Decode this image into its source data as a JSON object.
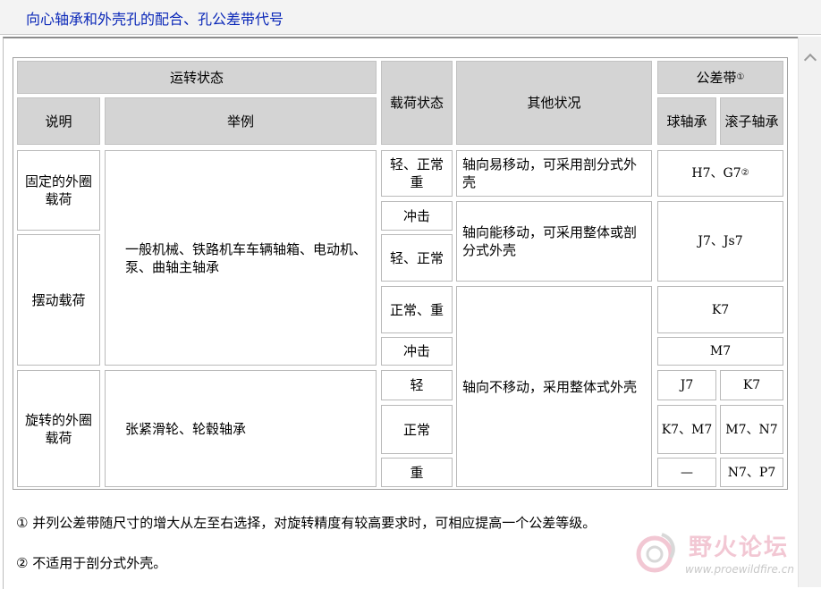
{
  "title": "向心轴承和外壳孔的配合、孔公差带代号",
  "table": {
    "headers": {
      "running_state": "运转状态",
      "description": "说明",
      "example": "举例",
      "load_state": "载荷状态",
      "other": "其他状况",
      "tolerance": "公差带",
      "tolerance_mark": "①",
      "ball": "球轴承",
      "roller": "滚子轴承"
    },
    "descriptions": [
      "固定的外圈载荷",
      "摆动载荷",
      "旋转的外圈载荷"
    ],
    "examples": [
      "一般机械、铁路机车车辆轴箱、电动机、泵、曲轴主轴承",
      "张紧滑轮、轮毂轴承"
    ],
    "loads": [
      "轻、正常重",
      "冲击",
      "轻、正常",
      "正常、重",
      "冲击",
      "轻",
      "正常",
      "重"
    ],
    "others": [
      "轴向易移动，可采用剖分式外壳",
      "轴向能移动，可采用整体或剖分式外壳",
      "轴向不移动，采用整体式外壳"
    ],
    "tolerances": {
      "r1": "H7、G7",
      "r1_mark": "②",
      "r2": "J7、Js7",
      "r3": "K7",
      "r4": "M7",
      "r5_ball": "J7",
      "r5_roller": "K7",
      "r6_ball": "K7、M7",
      "r6_roller": "M7、N7",
      "r7_ball": "—",
      "r7_roller": "N7、P7"
    }
  },
  "notes": [
    "①  并列公差带随尺寸的增大从左至右选择，对旋转精度有较高要求时，可相应提高一个公差等级。",
    "②  不适用于剖分式外壳。"
  ],
  "watermark": {
    "name": "野火论坛",
    "url": "www.proewildfire.cn",
    "color": "#e89ab0"
  }
}
